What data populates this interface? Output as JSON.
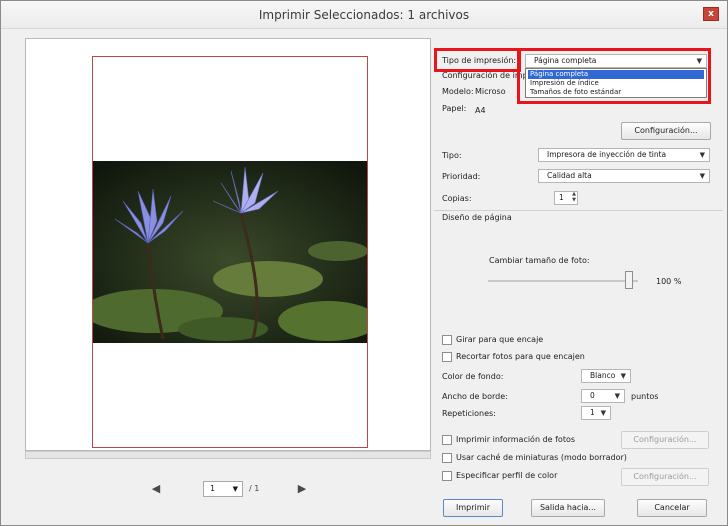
{
  "window": {
    "title": "Imprimir  Seleccionados: 1 archivos",
    "close_label": "x"
  },
  "preview": {
    "page_number": "1",
    "page_total": "/ 1"
  },
  "panel": {
    "print_type_label": "Tipo de impresión:",
    "print_type_value": "Página completa",
    "print_type_options": [
      "Página completa",
      "Impresión de índice",
      "Tamaños de foto estándar"
    ],
    "config_label": "Configuración de impr",
    "model_label": "Modelo:",
    "model_value": "Microso",
    "paper_label": "Papel:",
    "paper_value": "A4",
    "config_button": "Configuración...",
    "type_label": "Tipo:",
    "type_value": "Impresora de inyección de tinta",
    "priority_label": "Prioridad:",
    "priority_value": "Calidad alta",
    "copies_label": "Copias:",
    "copies_value": "1",
    "layout_group": "Diseño de página",
    "resize_label": "Cambiar tamaño de foto:",
    "resize_value": "100 %",
    "rotate_label": "Girar para que encaje",
    "crop_label": "Recortar fotos para que encajen",
    "bgcolor_label": "Color de fondo:",
    "bgcolor_value": "Blanco",
    "border_label": "Ancho de borde:",
    "border_value": "0",
    "border_unit": "puntos",
    "repeat_label": "Repeticiones:",
    "repeat_value": "1",
    "print_info_label": "Imprimir información de fotos",
    "info_config_button": "Configuración...",
    "thumb_cache_label": "Usar caché de miniaturas (modo borrador)",
    "color_profile_label": "Especificar perfil de color",
    "profile_config_button": "Configuración..."
  },
  "footer": {
    "print_button": "Imprimir",
    "output_button": "Salida hacia...",
    "cancel_button": "Cancelar"
  },
  "colors": {
    "highlight": "#e8141b",
    "selection": "#3268d6",
    "page_border": "#b24a4a"
  }
}
